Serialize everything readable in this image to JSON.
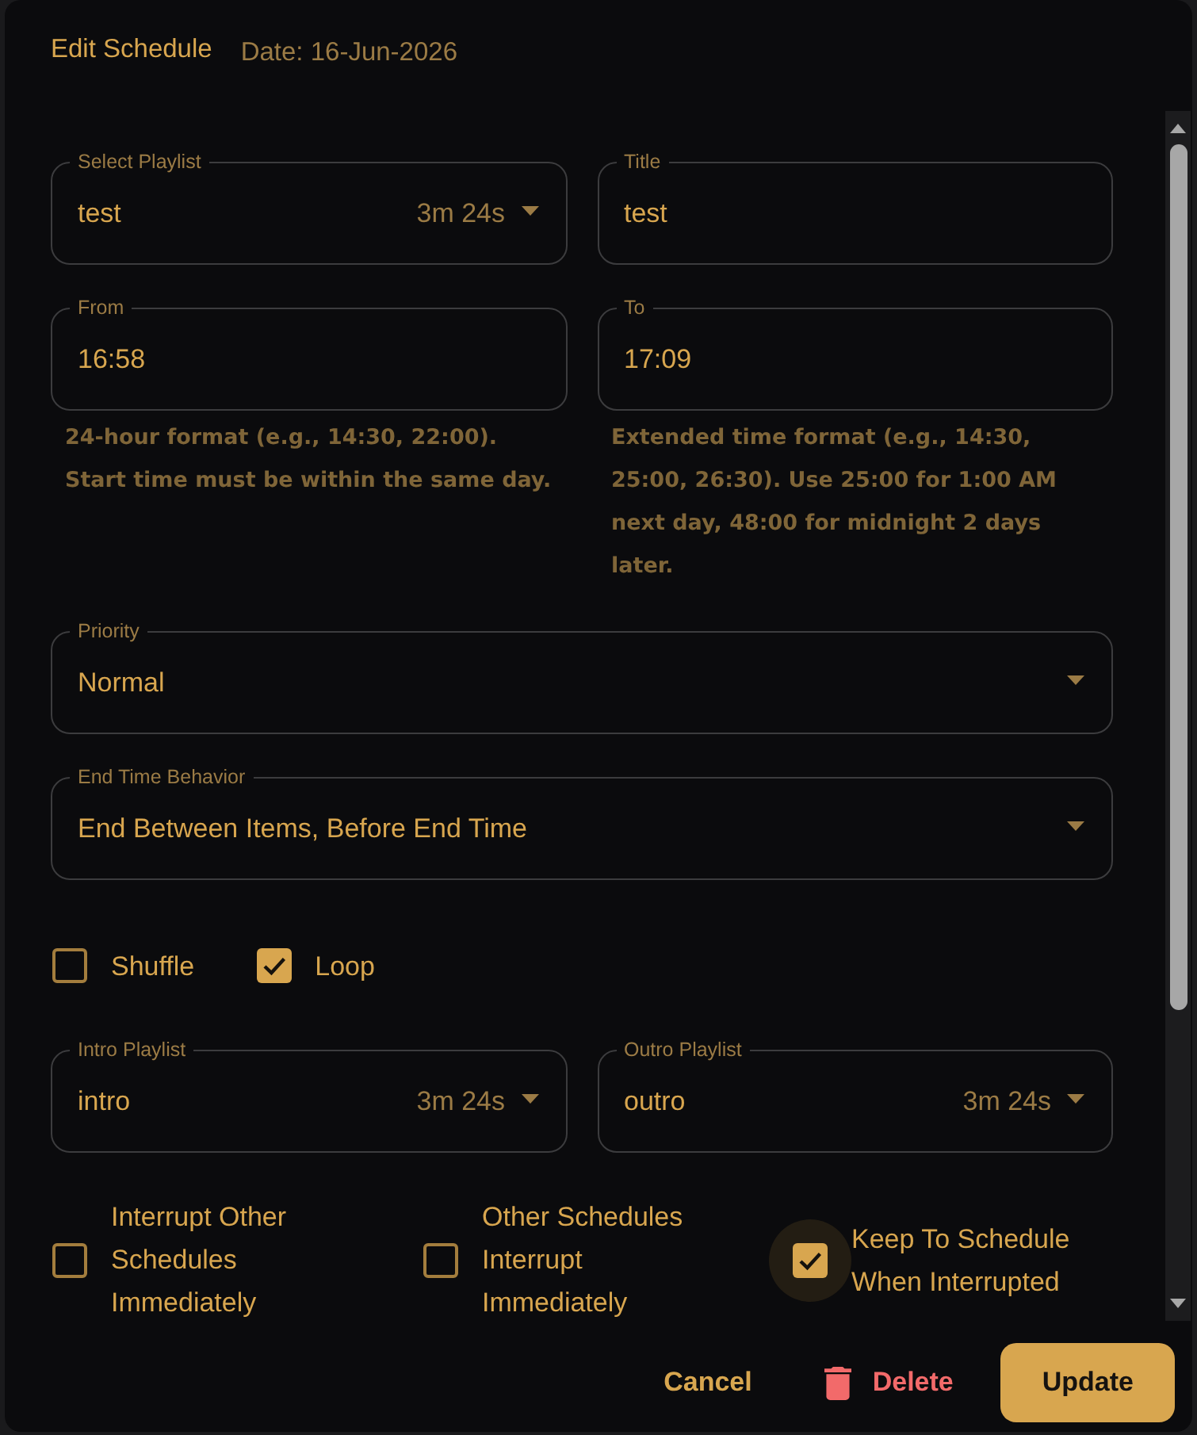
{
  "dialog": {
    "title": "Edit Schedule",
    "date": "Date: 16-Jun-2026"
  },
  "sections": [
    {
      "kind": "fields",
      "fields": [
        {
          "kind": "select",
          "label": "Select Playlist",
          "value": "test",
          "duration": "3m 24s"
        },
        {
          "kind": "text",
          "label": "Title",
          "value": "test"
        }
      ]
    },
    {
      "kind": "fields",
      "fields": [
        {
          "kind": "text",
          "label": "From",
          "value": "16:58",
          "helper": [
            "24-hour format (e.g., 14:30, 22:00).",
            "Start time must be within the same day."
          ]
        },
        {
          "kind": "text",
          "label": "To",
          "value": "17:09",
          "helper": [
            "Extended time format (e.g., 14:30, 25:00, 26:30). Use 25:00 for 1:00 AM next day, 48:00 for midnight 2 days later."
          ]
        }
      ]
    },
    {
      "kind": "fields",
      "fields": [
        {
          "kind": "select",
          "label": "Priority",
          "value": "Normal"
        }
      ]
    },
    {
      "kind": "fields",
      "fields": [
        {
          "kind": "select",
          "label": "End Time Behavior",
          "value": "End Between Items, Before End Time"
        }
      ]
    },
    {
      "kind": "checkboxes",
      "items": [
        {
          "label": "Shuffle",
          "checked": false,
          "focused": false
        },
        {
          "label": "Loop",
          "checked": true,
          "focused": false
        }
      ]
    },
    {
      "kind": "fields",
      "fields": [
        {
          "kind": "select",
          "label": "Intro Playlist",
          "value": "intro",
          "duration": "3m 24s"
        },
        {
          "kind": "select",
          "label": "Outro Playlist",
          "value": "outro",
          "duration": "3m 24s"
        }
      ]
    },
    {
      "kind": "wide_checkboxes",
      "items": [
        {
          "label": "Interrupt Other Schedules Immediately",
          "checked": false,
          "focused": false
        },
        {
          "label": "Other Schedules Interrupt Immediately",
          "checked": false,
          "focused": false
        },
        {
          "label": "Keep To Schedule When Interrupted",
          "checked": true,
          "focused": true
        }
      ]
    }
  ],
  "buttons": [
    {
      "kind": "text",
      "label": "Cancel"
    },
    {
      "kind": "danger",
      "label": "Delete"
    },
    {
      "kind": "primary",
      "label": "Update"
    }
  ]
}
